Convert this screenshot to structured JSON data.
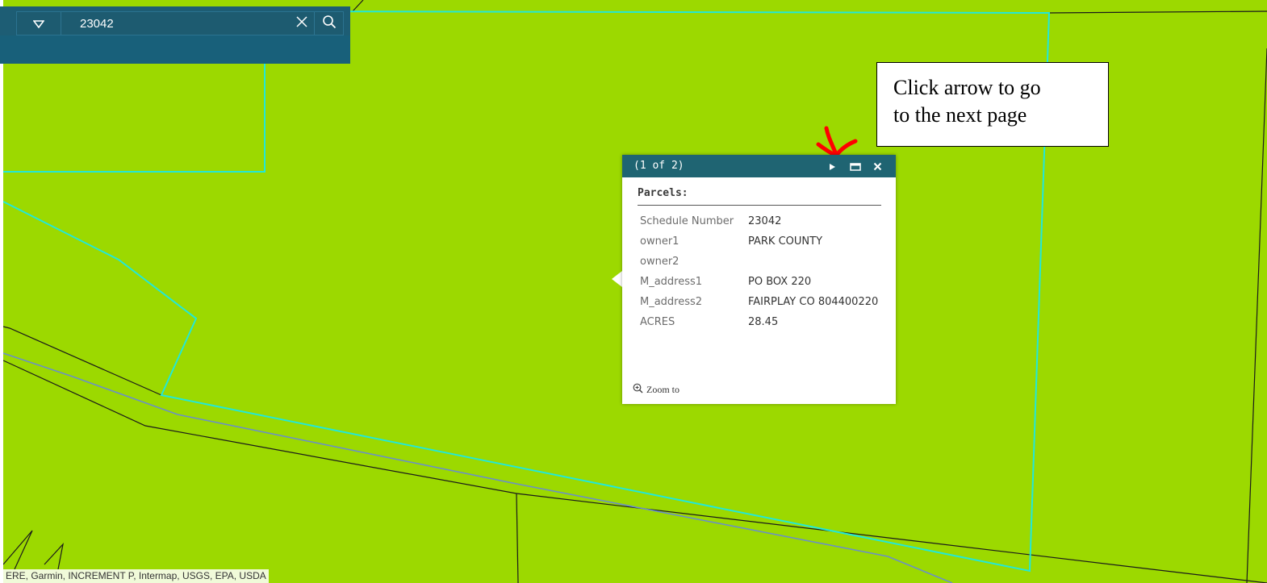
{
  "search": {
    "value": "23042",
    "dropdown_icon": "triangle-down-icon",
    "clear_icon": "close-icon",
    "search_icon": "search-icon"
  },
  "callout": {
    "line1": "Click arrow to go",
    "line2": "to the next page"
  },
  "popup": {
    "counter": "(1 of 2)",
    "next_icon": "play-next-icon",
    "maximize_icon": "maximize-icon",
    "close_icon": "close-icon",
    "layer_title": "Parcels:",
    "fields": [
      {
        "key": "Schedule Number",
        "value": "23042"
      },
      {
        "key": "owner1",
        "value": "PARK COUNTY"
      },
      {
        "key": "owner2",
        "value": ""
      },
      {
        "key": "M_address1",
        "value": "PO BOX 220"
      },
      {
        "key": "M_address2",
        "value": "FAIRPLAY CO 804400220"
      },
      {
        "key": "ACRES",
        "value": "28.45"
      }
    ],
    "zoom_label": "Zoom to",
    "zoom_icon": "zoom-in-icon"
  },
  "attribution": "ERE, Garmin, INCREMENT P, Intermap, USGS, EPA, USDA",
  "colors": {
    "map_fill": "#9cd900",
    "parcel_highlight": "#22e8d8",
    "parcel_line": "#1a1a1a",
    "road_line": "#6a8fc8",
    "header": "#1f6472",
    "annotation_arrow": "#ff0000"
  }
}
